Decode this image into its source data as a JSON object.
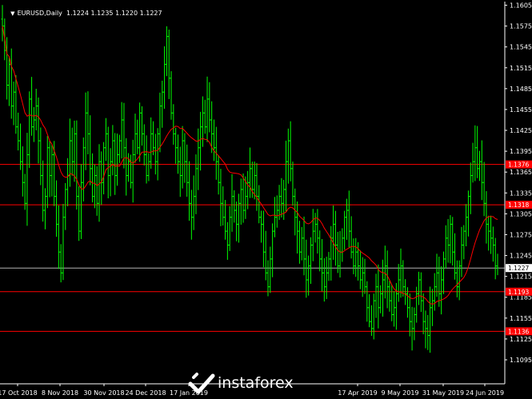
{
  "window": {
    "symbol_title": "EURUSD,Daily  1.1224 1.1235 1.1220 1.1227"
  },
  "colors": {
    "background": "#000000",
    "candle": "#00ff00",
    "moving_average": "#ff0000",
    "level_line": "#ff0000",
    "level_label_bg": "#ff0000",
    "current_price_line": "#b0b0b0",
    "text": "#ffffff"
  },
  "watermark": {
    "text": "instaforex",
    "icon": "instaforex-logo-icon"
  },
  "chart_data": {
    "type": "candlestick",
    "y_ticks": [
      "1.1605",
      "1.1575",
      "1.1545",
      "1.1515",
      "1.1485",
      "1.1455",
      "1.1425",
      "1.1395",
      "1.1365",
      "1.1335",
      "1.1305",
      "1.1275",
      "1.1245",
      "1.1215",
      "1.1185",
      "1.1155",
      "1.1125",
      "1.1095"
    ],
    "ylim": [
      1.1095,
      1.1605
    ],
    "x_ticks": [
      "17 Oct 2018",
      "8 Nov 2018",
      "30 Nov 2018",
      "24 Dec 2018",
      "17 Jan 2019",
      "17 Apr 2019",
      "9 May 2019",
      "31 May 2019",
      "24 Jun 2019"
    ],
    "levels": [
      {
        "value": 1.1376,
        "label": "1.1376"
      },
      {
        "value": 1.1318,
        "label": "1.1318"
      },
      {
        "value": 1.1193,
        "label": "1.1193"
      },
      {
        "value": 1.1136,
        "label": "1.1136"
      }
    ],
    "current_price": {
      "value": 1.1227,
      "label": "1.1227"
    },
    "series": [
      {
        "name": "EURUSD",
        "closes": [
          1.1575,
          1.154,
          1.149,
          1.152,
          1.146,
          1.148,
          1.143,
          1.141,
          1.138,
          1.135,
          1.132,
          1.139,
          1.147,
          1.143,
          1.144,
          1.146,
          1.141,
          1.136,
          1.131,
          1.133,
          1.14,
          1.136,
          1.139,
          1.133,
          1.129,
          1.125,
          1.122,
          1.13,
          1.134,
          1.136,
          1.141,
          1.138,
          1.142,
          1.133,
          1.128,
          1.135,
          1.14,
          1.145,
          1.142,
          1.137,
          1.133,
          1.136,
          1.132,
          1.138,
          1.135,
          1.14,
          1.142,
          1.136,
          1.138,
          1.141,
          1.136,
          1.139,
          1.141,
          1.144,
          1.14,
          1.136,
          1.138,
          1.135,
          1.139,
          1.142,
          1.14,
          1.145,
          1.142,
          1.139,
          1.136,
          1.138,
          1.142,
          1.14,
          1.138,
          1.142,
          1.146,
          1.148,
          1.152,
          1.156,
          1.15,
          1.145,
          1.142,
          1.14,
          1.138,
          1.136,
          1.141,
          1.138,
          1.135,
          1.132,
          1.13,
          1.133,
          1.137,
          1.14,
          1.143,
          1.145,
          1.143,
          1.147,
          1.144,
          1.142,
          1.14,
          1.138,
          1.135,
          1.132,
          1.13,
          1.128,
          1.126,
          1.13,
          1.133,
          1.131,
          1.129,
          1.132,
          1.134,
          1.131,
          1.133,
          1.135,
          1.137,
          1.134,
          1.136,
          1.133,
          1.13,
          1.129,
          1.125,
          1.122,
          1.12,
          1.124,
          1.128,
          1.13,
          1.131,
          1.133,
          1.132,
          1.134,
          1.138,
          1.141,
          1.137,
          1.133,
          1.13,
          1.128,
          1.125,
          1.127,
          1.124,
          1.121,
          1.123,
          1.126,
          1.128,
          1.129,
          1.127,
          1.124,
          1.122,
          1.12,
          1.122,
          1.124,
          1.127,
          1.129,
          1.126,
          1.123,
          1.125,
          1.127,
          1.13,
          1.131,
          1.128,
          1.125,
          1.123,
          1.125,
          1.123,
          1.121,
          1.122,
          1.12,
          1.117,
          1.115,
          1.114,
          1.118,
          1.12,
          1.117,
          1.119,
          1.121,
          1.123,
          1.12,
          1.118,
          1.116,
          1.117,
          1.119,
          1.121,
          1.123,
          1.12,
          1.119,
          1.117,
          1.115,
          1.114,
          1.116,
          1.119,
          1.121,
          1.118,
          1.115,
          1.114,
          1.113,
          1.117,
          1.118,
          1.12,
          1.122,
          1.119,
          1.121,
          1.124,
          1.127,
          1.126,
          1.129,
          1.125,
          1.122,
          1.12,
          1.123,
          1.126,
          1.128,
          1.13,
          1.133,
          1.136,
          1.138,
          1.14,
          1.137,
          1.138,
          1.135,
          1.132,
          1.129,
          1.128,
          1.127,
          1.126,
          1.123,
          1.1227
        ]
      }
    ]
  }
}
